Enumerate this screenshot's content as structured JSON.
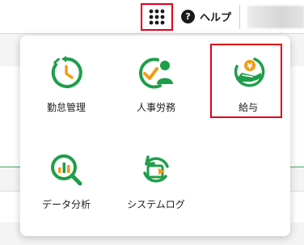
{
  "header": {
    "help_label": "ヘルプ",
    "help_glyph": "?"
  },
  "apps": [
    {
      "label": "勤怠管理",
      "icon": "attendance-clock-icon"
    },
    {
      "label": "人事労務",
      "icon": "hr-person-check-icon"
    },
    {
      "label": "給与",
      "icon": "payroll-yen-hand-icon"
    },
    {
      "label": "データ分析",
      "icon": "data-analysis-magnifier-icon"
    },
    {
      "label": "システムログ",
      "icon": "system-log-icon"
    }
  ],
  "colors": {
    "brand_green": "#1f9e4a",
    "accent_orange": "#f39c12",
    "highlight_red": "#e0001b"
  }
}
